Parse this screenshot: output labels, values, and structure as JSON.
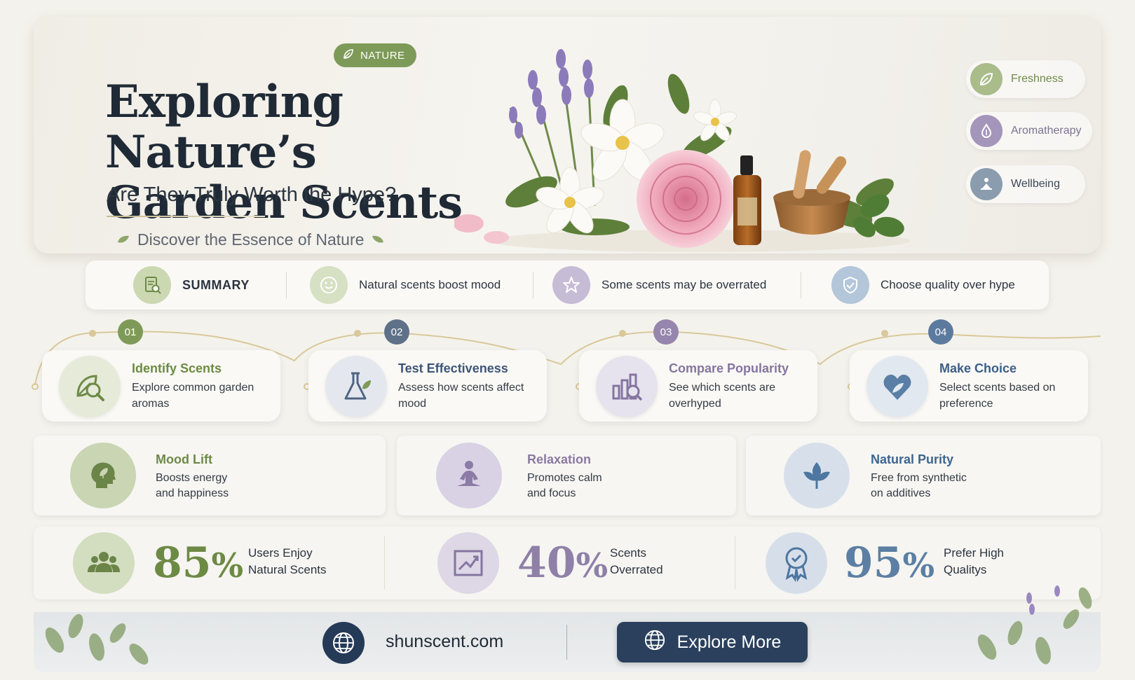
{
  "hero": {
    "tag": "NATURE",
    "title_line1": "Exploring Nature’s",
    "title_line2": "Garden Scents",
    "subtitle": "Are They Truly Worth the Hype?",
    "discover": "Discover the Essence of Nature",
    "chips": [
      {
        "label": "Freshness",
        "icon": "leaf-icon",
        "color": "#9bb07a"
      },
      {
        "label": "Aromatherapy",
        "icon": "aroma-icon",
        "color": "#a393b8"
      },
      {
        "label": "Wellbeing",
        "icon": "meditation-icon",
        "color": "#8597ab"
      }
    ]
  },
  "summary": {
    "heading": "SUMMARY",
    "items": [
      {
        "label": "Natural scents boost mood",
        "icon": "smile-icon"
      },
      {
        "label": "Some scents may be overrated",
        "icon": "star-icon"
      },
      {
        "label": "Choose quality over hype",
        "icon": "shield-check-icon"
      }
    ]
  },
  "steps": [
    {
      "number": "01",
      "title": "Identify Scents",
      "desc": "Explore common garden aromas",
      "color": "#7e9a58"
    },
    {
      "number": "02",
      "title": "Test Effectiveness",
      "desc": "Assess how scents affect mood",
      "color": "#5f7189"
    },
    {
      "number": "03",
      "title": "Compare Popularity",
      "desc": "See which scents are overhyped",
      "color": "#9686ad"
    },
    {
      "number": "04",
      "title": "Make Choice",
      "desc": "Select scents based on preference",
      "color": "#5b7a9e"
    }
  ],
  "benefits": [
    {
      "title": "Mood Lift",
      "desc1": "Boosts energy",
      "desc2": "and happiness",
      "color": "#6d8a45"
    },
    {
      "title": "Relaxation",
      "desc1": "Promotes calm",
      "desc2": "and focus",
      "color": "#8a7aa2"
    },
    {
      "title": "Natural Purity",
      "desc1": "Free from synthetic",
      "desc2": "on additives",
      "color": "#4a6c93"
    }
  ],
  "stats": [
    {
      "value": "85",
      "unit": "%",
      "label1": "Users Enjoy",
      "label2": "Natural Scents",
      "color": "#6d8a45"
    },
    {
      "value": "40",
      "unit": "%",
      "label1": "Scents",
      "label2": "Overrated",
      "color": "#8f80a8"
    },
    {
      "value": "95",
      "unit": "%",
      "label1": "Prefer High",
      "label2": "Qualitys",
      "color": "#5c7fa3"
    }
  ],
  "footer": {
    "site": "shunscent.com",
    "button": "Explore More"
  }
}
